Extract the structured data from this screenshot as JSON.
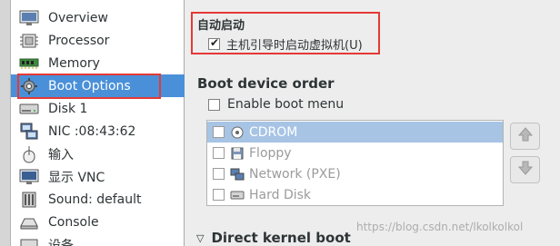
{
  "sidebar": {
    "items": [
      {
        "label": "Overview",
        "icon": "monitor-icon"
      },
      {
        "label": "Processor",
        "icon": "cpu-icon"
      },
      {
        "label": "Memory",
        "icon": "memory-icon"
      },
      {
        "label": "Boot Options",
        "icon": "gear-icon",
        "selected": true
      },
      {
        "label": "Disk 1",
        "icon": "disk-icon"
      },
      {
        "label": "NIC :08:43:62",
        "icon": "network-icon"
      },
      {
        "label": "输入",
        "icon": "mouse-icon"
      },
      {
        "label": "显示 VNC",
        "icon": "display-icon"
      },
      {
        "label": "Sound: default",
        "icon": "sound-icon"
      },
      {
        "label": "Console",
        "icon": "console-icon"
      },
      {
        "label": "设备",
        "icon": "device-icon"
      }
    ]
  },
  "autostart": {
    "title": "自动启动",
    "option_label": "主机引导时启动虚拟机(U)",
    "checked": true
  },
  "boot_order": {
    "title": "Boot device order",
    "enable_menu_label": "Enable boot menu",
    "enable_menu_checked": false,
    "devices": [
      {
        "label": "CDROM",
        "icon": "cdrom-icon",
        "selected": true
      },
      {
        "label": "Floppy",
        "icon": "floppy-icon"
      },
      {
        "label": "Network (PXE)",
        "icon": "network-icon"
      },
      {
        "label": "Hard Disk",
        "icon": "harddisk-icon"
      }
    ]
  },
  "direct_kernel": {
    "title": "Direct kernel boot"
  },
  "watermark": "https://blog.csdn.net/lkolkolkol",
  "colors": {
    "selection": "#4a90d9",
    "highlight_box": "#e53935"
  }
}
